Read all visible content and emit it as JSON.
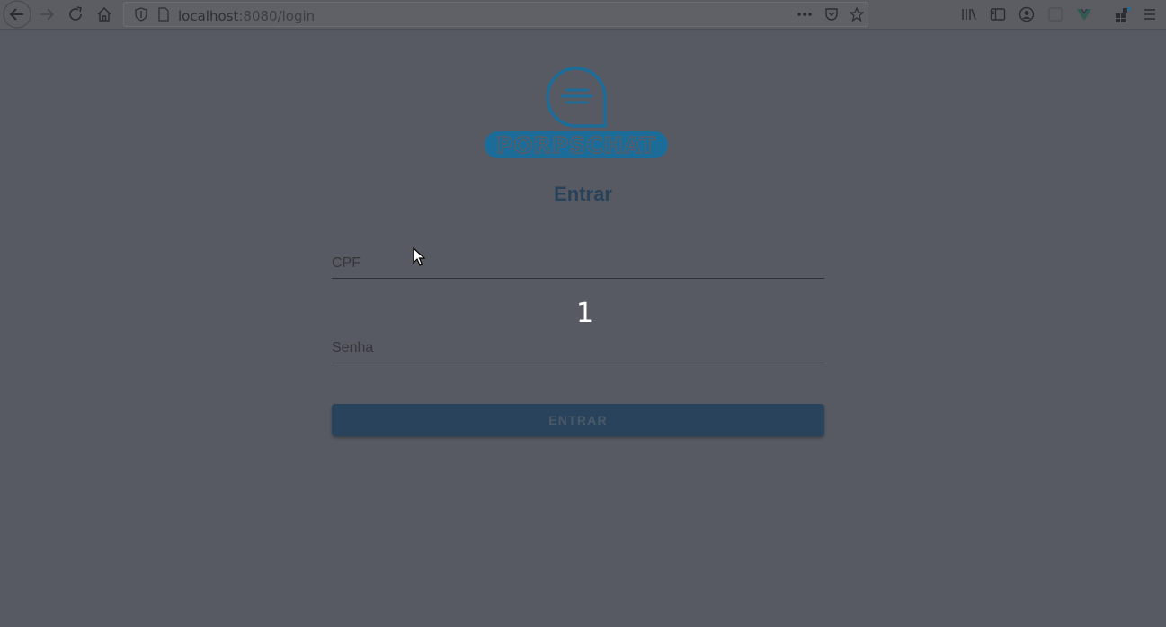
{
  "browser": {
    "url_host": "localhost",
    "url_rest": ":8080/login",
    "icons": [
      "back-icon",
      "forward-icon",
      "reload-icon",
      "home-icon",
      "shield-icon",
      "page-info-icon",
      "more-icon",
      "pocket-icon",
      "bookmark-star-icon",
      "library-icon",
      "sidebar-icon",
      "account-icon",
      "extension-icon",
      "vue-devtools-icon",
      "extensions-icon",
      "menu-icon"
    ]
  },
  "logo": {
    "text": "PORPSCHAT",
    "color": "#1c6c9a"
  },
  "login": {
    "title": "Entrar",
    "cpf_placeholder": "CPF",
    "password_placeholder": "Senha",
    "submit_label": "ENTRAR"
  },
  "overlay": {
    "number": "1"
  },
  "colors": {
    "background": "#575a62",
    "primary": "#28435b",
    "title": "#28425a"
  }
}
